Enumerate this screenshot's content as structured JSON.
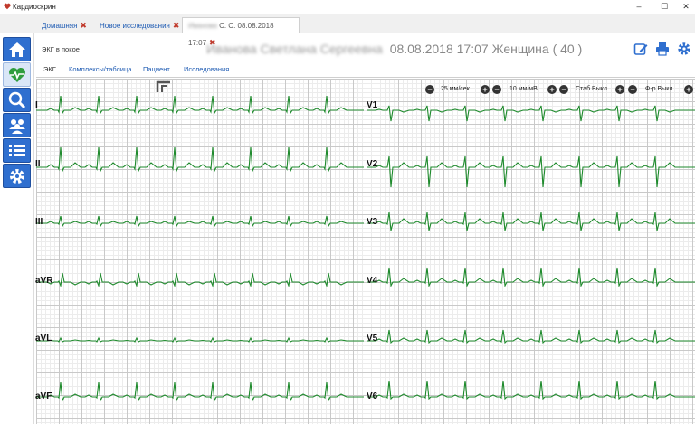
{
  "window": {
    "title": "Кардиоскрин",
    "controls": {
      "minimize": "–",
      "maximize": "☐",
      "close": "✕"
    }
  },
  "tabs": [
    {
      "label": "Домашняя",
      "active": false
    },
    {
      "label": "Новое исследования",
      "active": false
    },
    {
      "label_blurred": "Иванова",
      "label": "С. С. 08.08.2018 17:07",
      "active": true
    }
  ],
  "tab_close_glyph": "✖",
  "sidebar": {
    "items": [
      {
        "name": "home-icon"
      },
      {
        "name": "heart-pulse-icon"
      },
      {
        "name": "search-icon"
      },
      {
        "name": "users-icon"
      },
      {
        "name": "list-icon"
      },
      {
        "name": "gear-icon"
      }
    ]
  },
  "header": {
    "patient_name_blurred": "Иванова Светлана Сергеевна",
    "patient_details": "08.08.2018 17:07 Женщина ( 40 )",
    "actions": [
      "edit-icon",
      "print-icon",
      "settings-icon"
    ]
  },
  "subtabs": [
    {
      "label": "ЭКГ в покое",
      "active": true
    },
    {
      "label": "ЭКГ",
      "active": true
    },
    {
      "label": "Комплексы/таблица",
      "active": false
    },
    {
      "label": "Пациент",
      "active": false
    },
    {
      "label": "Исследования",
      "active": false
    }
  ],
  "controls": {
    "speed": "25 мм/сек",
    "amplitude": "10 мм/мВ",
    "stab": "Стаб.Выкл.",
    "filter": "Ф-р.Выкл.",
    "minus": "−",
    "plus": "+"
  },
  "leads_left": [
    "I",
    "II",
    "III",
    "aVR",
    "aVL",
    "aVF"
  ],
  "leads_right": [
    "V1",
    "V2",
    "V3",
    "V4",
    "V5",
    "V6"
  ],
  "colors": {
    "accent": "#2f6fcf",
    "trace": "#1e8a2c",
    "close_x": "#c0392b",
    "link": "#1e5bb3"
  }
}
